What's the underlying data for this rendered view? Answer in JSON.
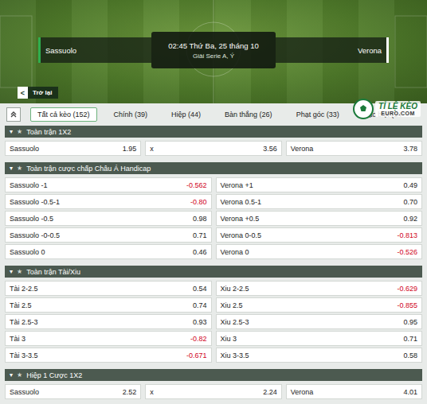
{
  "match": {
    "home": "Sassuolo",
    "away": "Verona",
    "time": "02:45 Thứ Ba, 25 tháng 10",
    "league": "Giải Serie A, Ý"
  },
  "back": {
    "icon": "<",
    "label": "Trở lại"
  },
  "tabs": [
    {
      "label": "Tất cả kèo (152)",
      "selected": true
    },
    {
      "label": "Chính (39)",
      "selected": false
    },
    {
      "label": "Hiệp (44)",
      "selected": false
    },
    {
      "label": "Bàn thắng (26)",
      "selected": false
    },
    {
      "label": "Phạt góc (33)",
      "selected": false
    },
    {
      "label": "Đặc biệt (14",
      "selected": false
    }
  ],
  "logo": {
    "line1": "TỈ LỆ KÈO",
    "line2": "EURO.COM"
  },
  "sections": [
    {
      "title": "Toàn trận 1X2",
      "toggle": "▾",
      "star": "★",
      "expanded": true,
      "kind": "three",
      "rows": [
        [
          {
            "label": "Sassuolo",
            "odd": "1.95",
            "negative": false
          },
          {
            "label": "x",
            "odd": "3.56",
            "negative": false
          },
          {
            "label": "Verona",
            "odd": "3.78",
            "negative": false
          }
        ]
      ]
    },
    {
      "title": "Toàn trận cược chấp Châu Á Handicap",
      "toggle": "▾",
      "star": "★",
      "expanded": true,
      "kind": "two",
      "rows": [
        [
          {
            "label": "Sassuolo -1",
            "odd": "-0.562",
            "negative": true
          },
          {
            "label": "Verona +1",
            "odd": "0.49",
            "negative": false
          }
        ],
        [
          {
            "label": "Sassuolo -0.5-1",
            "odd": "-0.80",
            "negative": true
          },
          {
            "label": "Verona 0.5-1",
            "odd": "0.70",
            "negative": false
          }
        ],
        [
          {
            "label": "Sassuolo -0.5",
            "odd": "0.98",
            "negative": false
          },
          {
            "label": "Verona +0.5",
            "odd": "0.92",
            "negative": false
          }
        ],
        [
          {
            "label": "Sassuolo -0-0.5",
            "odd": "0.71",
            "negative": false
          },
          {
            "label": "Verona 0-0.5",
            "odd": "-0.813",
            "negative": true
          }
        ],
        [
          {
            "label": "Sassuolo 0",
            "odd": "0.46",
            "negative": false
          },
          {
            "label": "Verona 0",
            "odd": "-0.526",
            "negative": true
          }
        ]
      ]
    },
    {
      "title": "Toàn trận Tài/Xiu",
      "toggle": "▾",
      "star": "★",
      "expanded": true,
      "kind": "two",
      "rows": [
        [
          {
            "label": "Tài 2-2.5",
            "odd": "0.54",
            "negative": false
          },
          {
            "label": "Xiu 2-2.5",
            "odd": "-0.629",
            "negative": true
          }
        ],
        [
          {
            "label": "Tài 2.5",
            "odd": "0.74",
            "negative": false
          },
          {
            "label": "Xiu 2.5",
            "odd": "-0.855",
            "negative": true
          }
        ],
        [
          {
            "label": "Tài 2.5-3",
            "odd": "0.93",
            "negative": false
          },
          {
            "label": "Xiu 2.5-3",
            "odd": "0.95",
            "negative": false
          }
        ],
        [
          {
            "label": "Tài 3",
            "odd": "-0.82",
            "negative": true
          },
          {
            "label": "Xiu 3",
            "odd": "0.71",
            "negative": false
          }
        ],
        [
          {
            "label": "Tài 3-3.5",
            "odd": "-0.671",
            "negative": true
          },
          {
            "label": "Xiu 3-3.5",
            "odd": "0.58",
            "negative": false
          }
        ]
      ]
    },
    {
      "title": "Hiệp 1 Cược 1X2",
      "toggle": "▾",
      "star": "★",
      "expanded": true,
      "kind": "three",
      "rows": [
        [
          {
            "label": "Sassuolo",
            "odd": "2.52",
            "negative": false
          },
          {
            "label": "x",
            "odd": "2.24",
            "negative": false
          },
          {
            "label": "Verona",
            "odd": "4.01",
            "negative": false
          }
        ]
      ]
    }
  ]
}
